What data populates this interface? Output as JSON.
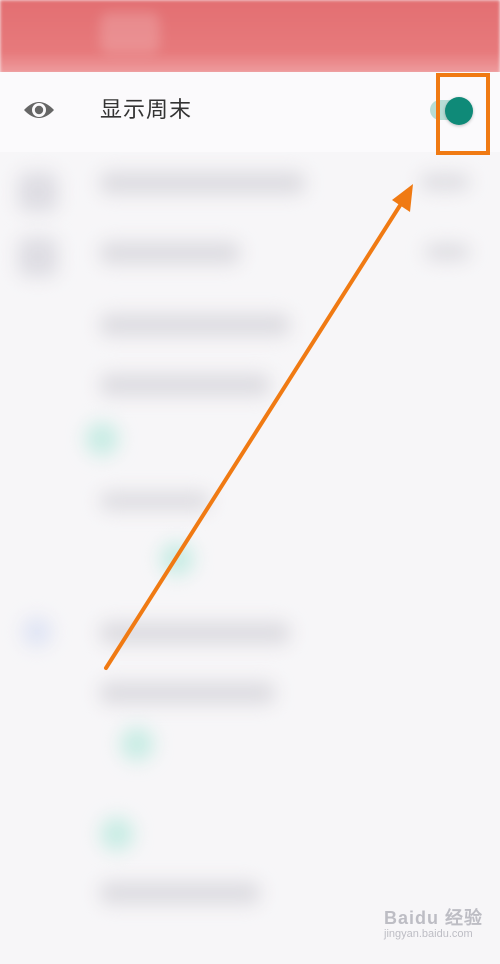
{
  "setting": {
    "label": "显示周末",
    "toggle_state": "on"
  },
  "colors": {
    "header": "#e36f72",
    "toggle_on": "#0f8a78",
    "toggle_track": "#b7ddd6",
    "annotation": "#f07a13"
  },
  "icons": {
    "visibility": "eye-icon"
  },
  "watermark": {
    "brand": "Baidu 经验",
    "url": "jingyan.baidu.com"
  }
}
